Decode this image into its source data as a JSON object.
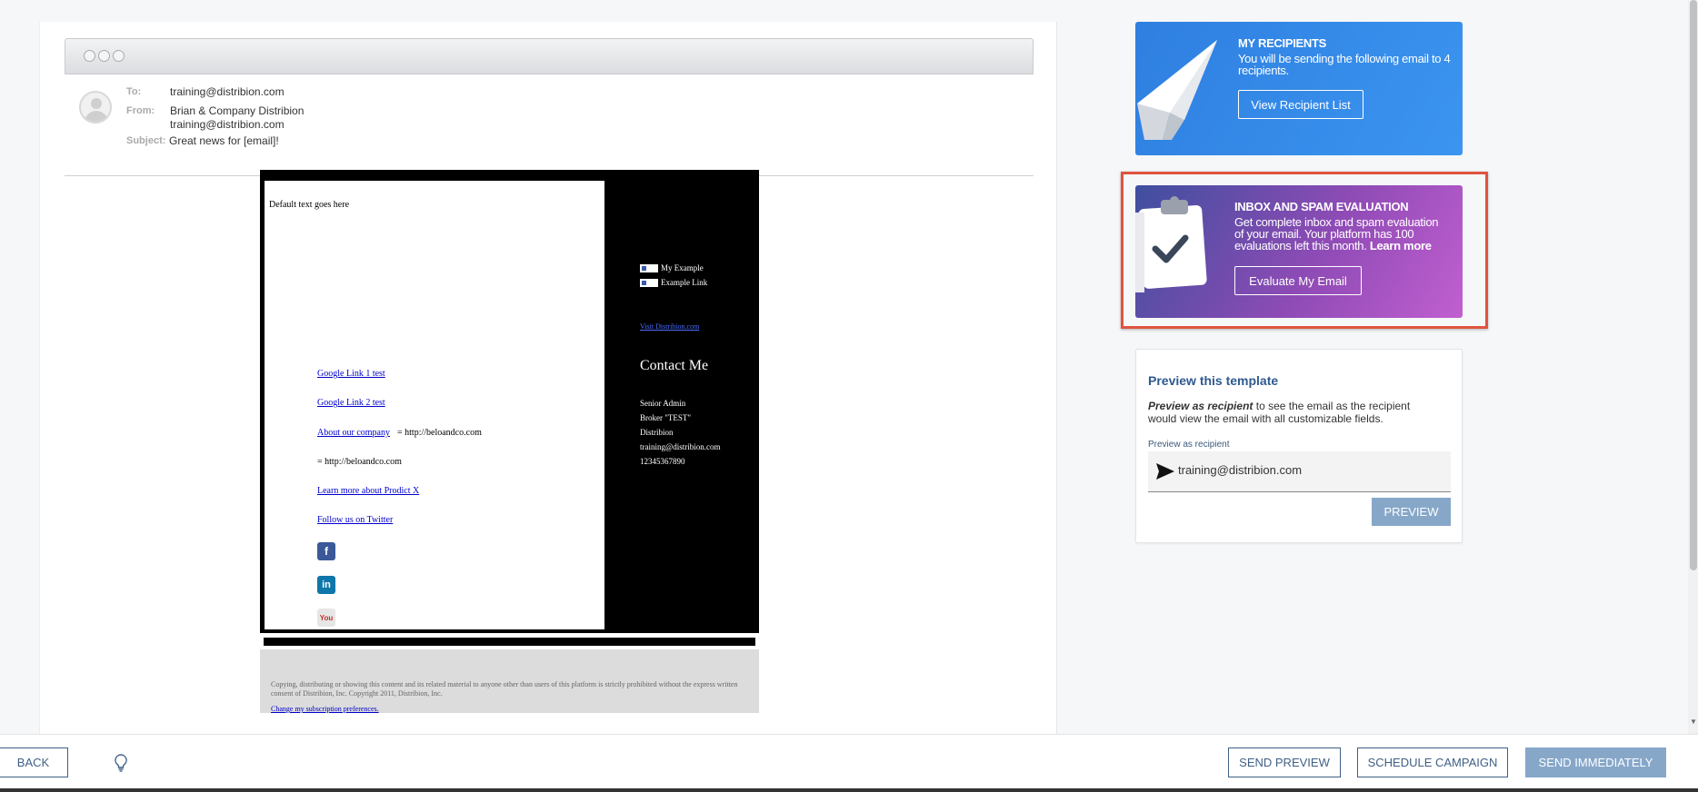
{
  "email_header": {
    "to_label": "To:",
    "to_value": "training@distribion.com",
    "from_label": "From:",
    "from_name": "Brian & Company Distribion",
    "from_email": "training@distribion.com",
    "subject_label": "Subject:",
    "subject_value": "Great news for [email]!"
  },
  "email_body": {
    "default_text": "Default text goes here",
    "links": [
      "Google Link 1 test",
      "Google Link 2 test"
    ],
    "about_link": "About our company",
    "about_suffix": "= http://beloandco.com",
    "plain_line": "= http://beloandco.com",
    "learn_link": "Learn more about Prodict X",
    "twitter_link": "Follow us on Twitter",
    "social_icons": [
      "facebook-icon",
      "linkedin-icon",
      "youtube-icon"
    ],
    "side_checks": [
      "My Example",
      "Example Link"
    ],
    "side_link": "Visit Distribion.com",
    "contact_heading": "Contact Me",
    "contact_lines": [
      "Senior Admin",
      "Broker \"TEST\"",
      "Distribion",
      "training@distribion.com",
      "12345367890"
    ],
    "footer_text": "Copying, distributing or showing this content and its related material to anyone other than users of this platform is strictly prohibited without the express written consent of Distribion, Inc.  Copyright 2011, Distribion, Inc.",
    "footer_link": "Change my subscription preferences."
  },
  "recipients_card": {
    "title": "MY RECIPIENTS",
    "text": "You will be sending the following email to 4 recipients.",
    "button": "View Recipient List",
    "icon": "paper-plane-icon"
  },
  "spam_card": {
    "title": "INBOX AND SPAM EVALUATION",
    "text": "Get complete inbox and spam evaluation of your email. Your platform has 100 evaluations left this month.",
    "learn_more": "Learn more",
    "button": "Evaluate My Email",
    "icon": "clipboard-check-icon"
  },
  "preview_card": {
    "title": "Preview this template",
    "desc_emphasis": "Preview as recipient",
    "desc_rest": " to see the email as the recipient would view the email with all customizable fields.",
    "field_label": "Preview as recipient",
    "field_value": "training@distribion.com",
    "button": "PREVIEW"
  },
  "footer": {
    "back": "BACK",
    "send_preview": "SEND PREVIEW",
    "schedule": "SCHEDULE CAMPAIGN",
    "send_now": "SEND IMMEDIATELY",
    "tip_icon": "lightbulb-icon"
  },
  "colors": {
    "recipients_card": "#3389e8",
    "spam_card_start": "#3f4f9f",
    "spam_card_end": "#c15fd0",
    "highlight_outline": "#e0533f",
    "primary_button": "#87a7c9",
    "nav_text": "#3f5f86"
  }
}
